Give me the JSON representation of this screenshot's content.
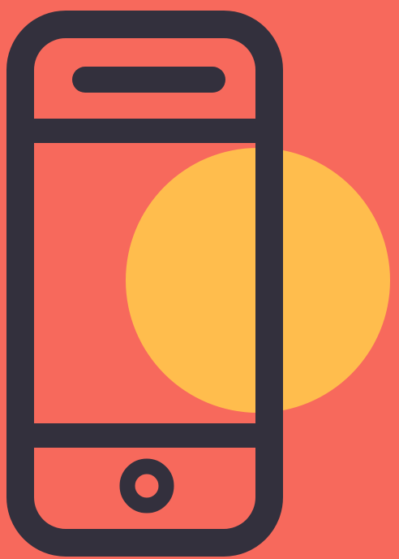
{
  "illustration": {
    "subject": "smartphone-icon",
    "colors": {
      "background": "#F7695C",
      "accent_circle": "#FFBD4D",
      "outline": "#33303D"
    }
  }
}
